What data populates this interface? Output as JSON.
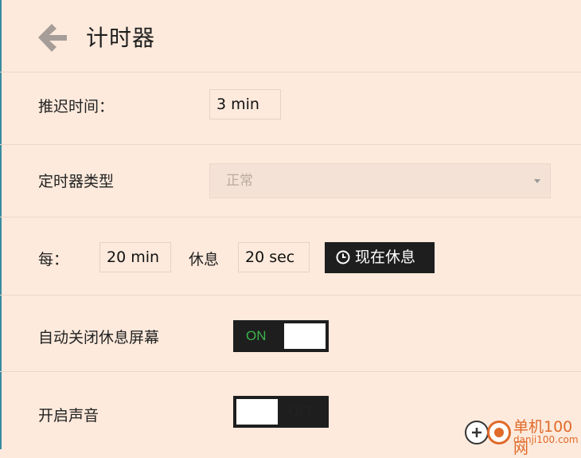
{
  "header": {
    "title": "计时器"
  },
  "delay": {
    "label": "推迟时间：",
    "value": "3 min"
  },
  "timer_type": {
    "label": "定时器类型",
    "selected": "正常"
  },
  "interval": {
    "every_label": "每：",
    "every_value": "20 min",
    "rest_label": "休息",
    "rest_value": "20 sec",
    "rest_now_label": "现在休息"
  },
  "auto_close": {
    "label": "自动关闭休息屏幕",
    "state": "ON"
  },
  "sound": {
    "label": "开启声音",
    "state": "OFF"
  },
  "watermark": {
    "name": "单机100网",
    "url": "danji100.com"
  },
  "colors": {
    "background": "#fdeadc",
    "dark": "#1e1e1e",
    "on_green": "#3bb34a",
    "watermark_orange": "#e06a2a"
  }
}
